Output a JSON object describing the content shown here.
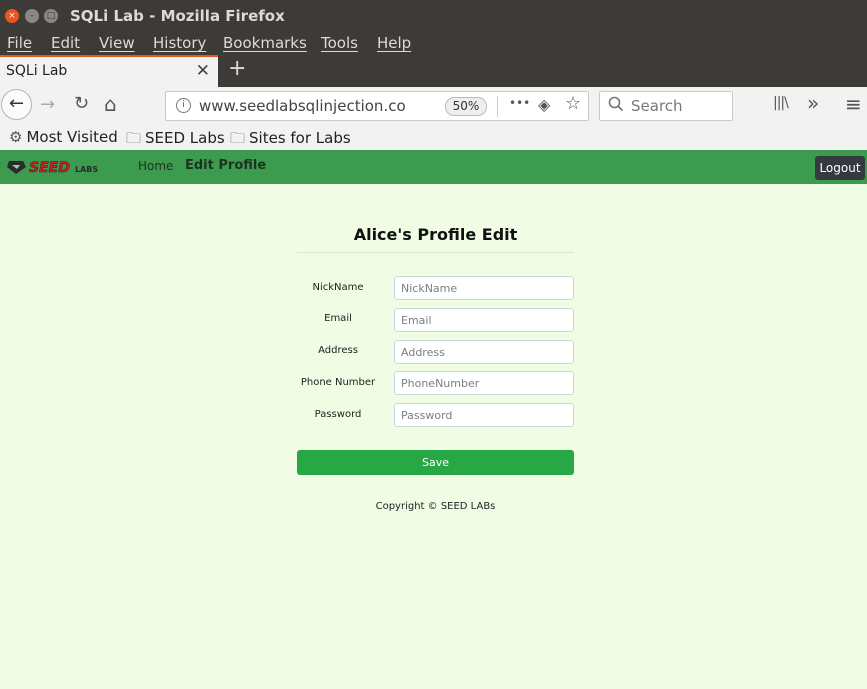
{
  "window": {
    "title": "SQLi Lab - Mozilla Firefox",
    "close_glyph": "×",
    "min_glyph": "–",
    "max_glyph": "□"
  },
  "menubar": {
    "items": [
      "File",
      "Edit",
      "View",
      "History",
      "Bookmarks",
      "Tools",
      "Help"
    ]
  },
  "tabs": [
    {
      "label": "SQLi Lab",
      "close_glyph": "✕"
    }
  ],
  "new_tab_glyph": "+",
  "nav": {
    "back_glyph": "←",
    "forward_glyph": "→",
    "reload_glyph": "↻",
    "home_glyph": "⌂",
    "url": "www.seedlabsqlinjection.com",
    "zoom": "50%",
    "more_glyph": "•••",
    "pocket_glyph": "◈",
    "star_glyph": "☆",
    "search_placeholder": "Search",
    "library_glyph": "|||\\",
    "overflow_glyph": "»",
    "menu_glyph": "≡"
  },
  "bookmarks": [
    {
      "label": "Most Visited",
      "icon": "gear-icon",
      "glyph": "⚙"
    },
    {
      "label": "SEED Labs",
      "icon": "folder-icon",
      "glyph": "🗀"
    },
    {
      "label": "Sites for Labs",
      "icon": "folder-icon",
      "glyph": "🗀"
    }
  ],
  "site": {
    "logo": {
      "text_main": "SEED",
      "text_sub": "LABS"
    },
    "nav_home": "Home",
    "nav_edit": "Edit Profile",
    "logout": "Logout"
  },
  "form": {
    "title": "Alice's Profile Edit",
    "fields": [
      {
        "label": "NickName",
        "placeholder": "NickName"
      },
      {
        "label": "Email",
        "placeholder": "Email"
      },
      {
        "label": "Address",
        "placeholder": "Address"
      },
      {
        "label": "Phone Number",
        "placeholder": "PhoneNumber"
      },
      {
        "label": "Password",
        "placeholder": "Password"
      }
    ],
    "save_label": "Save",
    "copyright": "Copyright © SEED LABs"
  },
  "colors": {
    "titlebar": "#3c3b37",
    "accent_orange": "#e95420",
    "site_nav_green": "#3d9b4f",
    "page_bg": "#f0fde4",
    "save_green": "#28a745",
    "logout_dark": "#343a40"
  }
}
